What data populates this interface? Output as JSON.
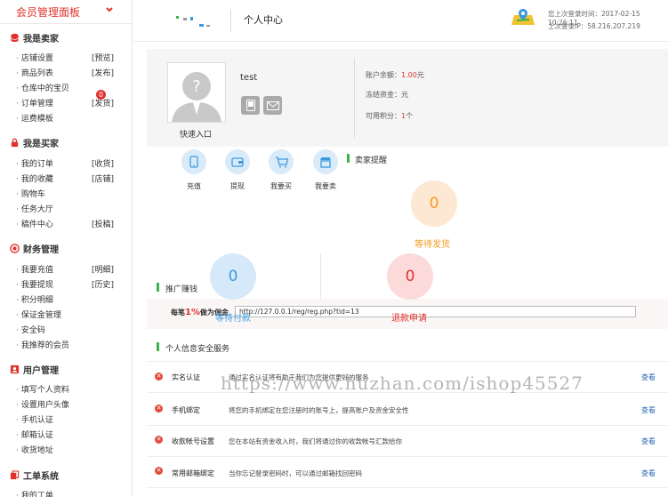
{
  "sidebar": {
    "title": "会员管理面板",
    "sections": [
      {
        "label": "我是卖家"
      },
      {
        "label": "我是买家"
      },
      {
        "label": "财务管理"
      },
      {
        "label": "用户管理"
      },
      {
        "label": "工单系统"
      }
    ],
    "seller_items": [
      {
        "label": "店铺设置",
        "tag": "[预览]"
      },
      {
        "label": "商品列表",
        "tag": "[发布]"
      },
      {
        "label": "仓库中的宝贝",
        "tag": ""
      },
      {
        "label": "订单管理",
        "tag": "[发货]"
      },
      {
        "label": "运费模板",
        "tag": ""
      }
    ],
    "order_badge": "0",
    "buyer_items": [
      {
        "label": "我的订单",
        "tag": "[收货]"
      },
      {
        "label": "我的收藏",
        "tag": "[店铺]"
      },
      {
        "label": "购物车",
        "tag": ""
      },
      {
        "label": "任务大厅",
        "tag": ""
      },
      {
        "label": "稿件中心",
        "tag": "[投稿]"
      }
    ],
    "finance_items": [
      {
        "label": "我要充值",
        "tag": "[明细]"
      },
      {
        "label": "我要提现",
        "tag": "[历史]"
      },
      {
        "label": "积分明细",
        "tag": ""
      },
      {
        "label": "保证金管理",
        "tag": ""
      },
      {
        "label": "安全码",
        "tag": ""
      },
      {
        "label": "我推荐的会员",
        "tag": ""
      }
    ],
    "user_items": [
      {
        "label": "填写个人资料",
        "tag": ""
      },
      {
        "label": "设置用户头像",
        "tag": ""
      },
      {
        "label": "手机认证",
        "tag": ""
      },
      {
        "label": "邮箱认证",
        "tag": ""
      },
      {
        "label": "收货地址",
        "tag": ""
      }
    ],
    "ticket_items": [
      {
        "label": "我的工单",
        "tag": ""
      }
    ]
  },
  "header": {
    "page_title": "个人中心",
    "last_login_time": "您上次登录时间：2017-02-15 10:26:11",
    "last_login_ip": "上次登录IP：58.216.207.219"
  },
  "profile": {
    "username": "test",
    "quick_entry": "快速入口",
    "balance_label": "账户余额：",
    "balance_value": "1.00",
    "balance_unit": "元",
    "frozen_label": "冻结资金：",
    "frozen_unit": "元",
    "points_label": "可用积分：",
    "points_value": "1",
    "points_unit": "个"
  },
  "quick_actions": [
    {
      "label": "充值",
      "icon": "phone-icon"
    },
    {
      "label": "提现",
      "icon": "wallet-icon"
    },
    {
      "label": "我要买",
      "icon": "cart-icon"
    },
    {
      "label": "我要卖",
      "icon": "shop-icon"
    }
  ],
  "seller_reminder": {
    "title": "卖家提醒",
    "wait_ship_count": "0",
    "wait_ship_label": "等待发货",
    "wait_pay_count": "0",
    "wait_pay_label": "等待付款",
    "refund_count": "0",
    "refund_label": "退款申请"
  },
  "promo": {
    "title": "推广赚钱",
    "text_prefix": "每笔",
    "percent": "1%",
    "text_suffix": "做为佣金",
    "link": "http://127.0.0.1/reg/reg.php?tid=13"
  },
  "security": {
    "title": "个人信息安全服务",
    "rows": [
      {
        "name": "实名认证",
        "desc": "通过实名认证将有助于我们为您提供更好的服务",
        "action": "查看"
      },
      {
        "name": "手机绑定",
        "desc": "将您的手机绑定在您注册时的账号上，提高账户及资金安全性",
        "action": "查看"
      },
      {
        "name": "收款帐号设置",
        "desc": "您在本站有资金收入时，我们将通过你的收款帐号汇款给你",
        "action": "查看"
      },
      {
        "name": "常用邮箱绑定",
        "desc": "当你忘记登录密码时，可以通过邮箱找回密码",
        "action": "查看"
      }
    ]
  },
  "watermark": "https://www.huzhan.com/ishop45527",
  "colors": {
    "accent": "#e0322c",
    "green": "#3bb54a",
    "blue": "#3a9ae0",
    "orange": "#f59a23"
  }
}
